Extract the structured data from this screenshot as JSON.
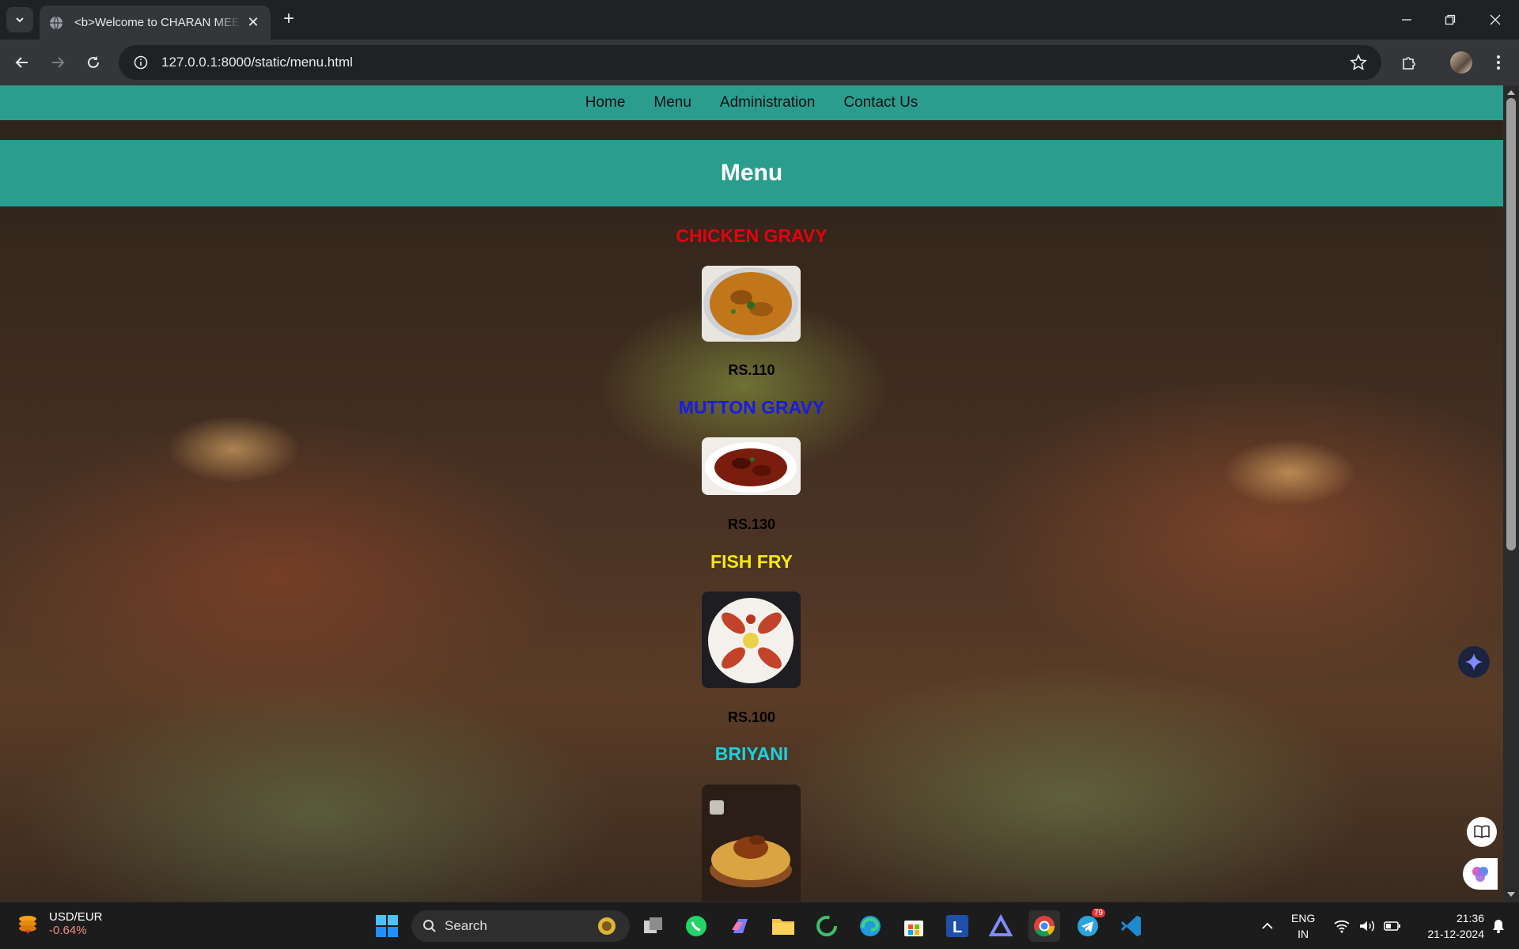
{
  "browser": {
    "tab_title": "<b>Welcome to CHARAN MEE",
    "url": "127.0.0.1:8000/static/menu.html"
  },
  "nav": [
    "Home",
    "Menu",
    "Administration",
    "Contact Us"
  ],
  "page": {
    "heading": "Menu",
    "items": [
      {
        "name": "CHICKEN GRAVY",
        "price": "RS.110",
        "color": "#e8000f",
        "image": "chicken-gravy-image"
      },
      {
        "name": "MUTTON GRAVY",
        "price": "RS.130",
        "color": "#1a1ae6",
        "image": "mutton-gravy-image"
      },
      {
        "name": "FISH FRY",
        "price": "RS.100",
        "color": "#f2ea0f",
        "image": "fish-fry-image"
      },
      {
        "name": "BRIYANI",
        "price": "",
        "color": "#19d3e0",
        "image": "briyani-image"
      }
    ]
  },
  "colors": {
    "nav_bg": "#2a9d8f",
    "header_bg": "#2a9d8f"
  },
  "taskbar": {
    "widget_title": "USD/EUR",
    "widget_value": "-0.64%",
    "search_placeholder": "Search",
    "lang_1": "ENG",
    "lang_2": "IN",
    "time": "21:36",
    "date": "21-12-2024",
    "telegram_badge": "79"
  }
}
